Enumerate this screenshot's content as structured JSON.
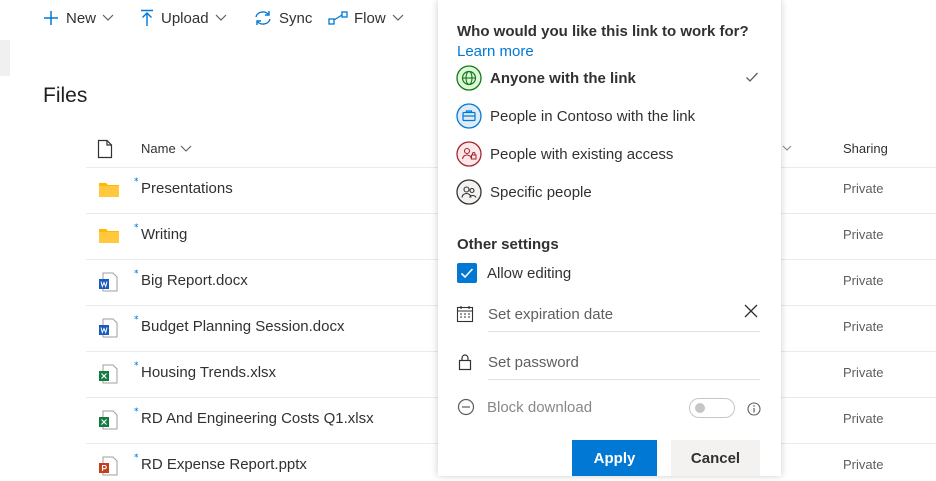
{
  "commandbar": {
    "new_label": "New",
    "upload_label": "Upload",
    "sync_label": "Sync",
    "flow_label": "Flow"
  },
  "files": {
    "title": "Files",
    "columns": {
      "name": "Name",
      "sharing": "Sharing"
    },
    "rows": [
      {
        "name": "Presentations",
        "type": "folder",
        "sharing": "Private"
      },
      {
        "name": "Writing",
        "type": "folder",
        "sharing": "Private"
      },
      {
        "name": "Big Report.docx",
        "type": "word",
        "sharing": "Private"
      },
      {
        "name": "Budget Planning Session.docx",
        "type": "word",
        "sharing": "Private"
      },
      {
        "name": "Housing Trends.xlsx",
        "type": "excel",
        "sharing": "Private"
      },
      {
        "name": "RD And Engineering Costs Q1.xlsx",
        "type": "excel",
        "sharing": "Private"
      },
      {
        "name": "RD Expense Report.pptx",
        "type": "powerpoint",
        "sharing": "Private"
      }
    ]
  },
  "link_panel": {
    "question": "Who would you like this link to work for?",
    "learn_more": "Learn more",
    "options": [
      {
        "label": "Anyone with the link",
        "icon": "globe-icon",
        "selected": true,
        "color": "#107c10"
      },
      {
        "label": "People in Contoso with the link",
        "icon": "briefcase-icon",
        "selected": false,
        "color": "#0078d4"
      },
      {
        "label": "People with existing access",
        "icon": "people-lock-icon",
        "selected": false,
        "color": "#a4262c"
      },
      {
        "label": "Specific people",
        "icon": "people-icon",
        "selected": false,
        "color": "#323130"
      }
    ],
    "other_settings": "Other settings",
    "allow_editing": {
      "label": "Allow editing",
      "checked": true
    },
    "expiration": {
      "placeholder": "Set expiration date"
    },
    "password": {
      "placeholder": "Set password"
    },
    "block_download": {
      "label": "Block download",
      "enabled": false
    },
    "apply_label": "Apply",
    "cancel_label": "Cancel"
  },
  "colors": {
    "accent": "#0078d4",
    "folder": "#ffb900",
    "word": "#185abd",
    "excel": "#107c41",
    "powerpoint": "#c43e1c"
  }
}
